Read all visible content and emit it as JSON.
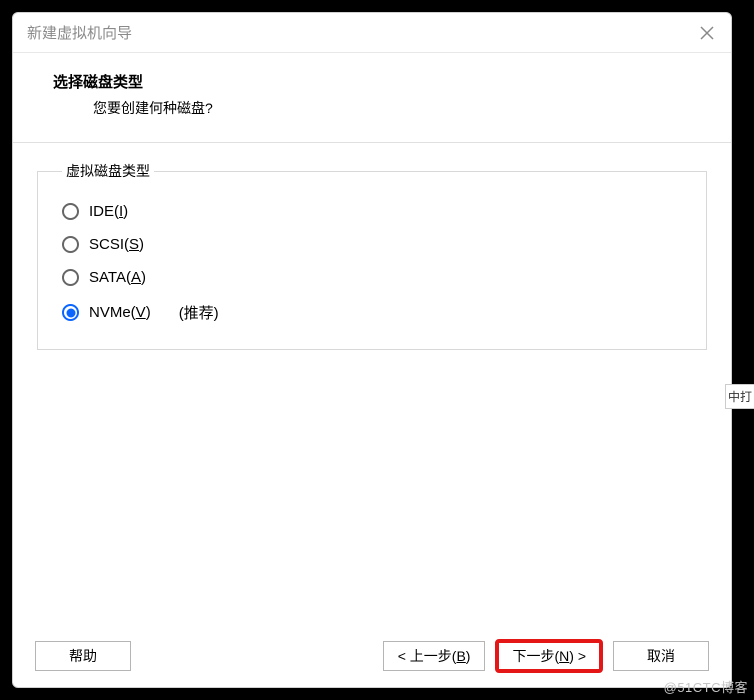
{
  "window": {
    "title": "新建虚拟机向导"
  },
  "header": {
    "title": "选择磁盘类型",
    "subtitle": "您要创建何种磁盘?"
  },
  "group": {
    "legend": "虚拟磁盘类型",
    "options": [
      {
        "label": "IDE(",
        "accel": "I",
        "label_after": ")",
        "selected": false,
        "recommended": ""
      },
      {
        "label": "SCSI(",
        "accel": "S",
        "label_after": ")",
        "selected": false,
        "recommended": ""
      },
      {
        "label": "SATA(",
        "accel": "A",
        "label_after": ")",
        "selected": false,
        "recommended": ""
      },
      {
        "label": "NVMe(",
        "accel": "V",
        "label_after": ")",
        "selected": true,
        "recommended": "(推荐)"
      }
    ]
  },
  "footer": {
    "help": "帮助",
    "back_pre": "< 上一步(",
    "back_accel": "B",
    "back_post": ")",
    "next_pre": "下一步(",
    "next_accel": "N",
    "next_post": ") >",
    "cancel": "取消"
  },
  "watermark": "@51CTC博客",
  "side_tab": "中打"
}
